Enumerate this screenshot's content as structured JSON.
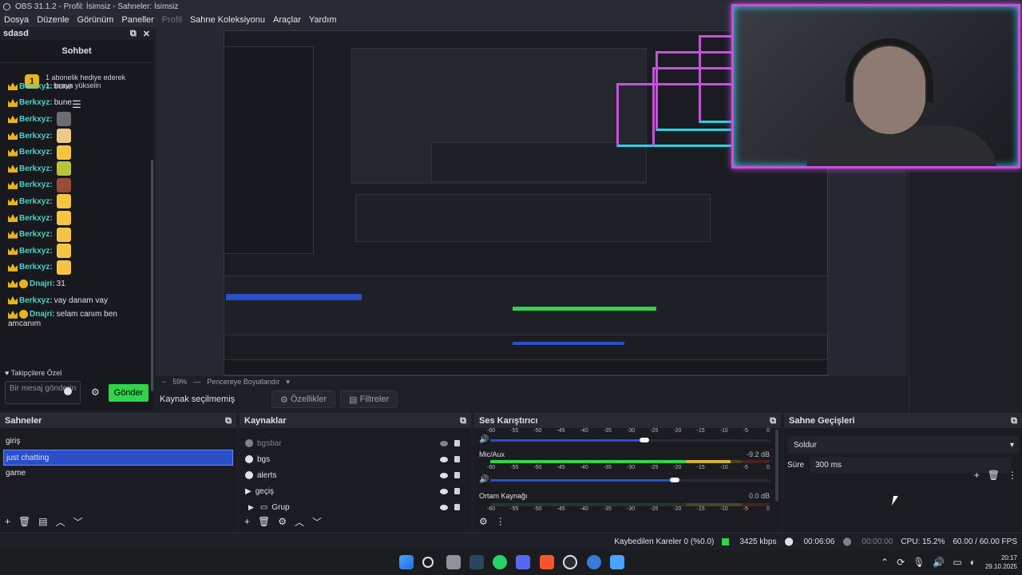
{
  "window": {
    "title": "OBS 31.1.2 - Profil: İsimsiz - Sahneler: İsimsiz"
  },
  "menu": {
    "items": [
      "Dosya",
      "Düzenle",
      "Görünüm",
      "Paneller",
      "Profil",
      "Sahne Koleksiyonu",
      "Araçlar",
      "Yardım"
    ],
    "disabled": "Profil"
  },
  "chat": {
    "dock_title": "sdasd",
    "title": "Sohbet",
    "promo_badge": "1",
    "promo_line1": "1 abonelik hediye ederek",
    "promo_line2": "1. sıraya yükselin",
    "messages": [
      {
        "badge": "crown",
        "user": "Berkxyz:",
        "text": "bune",
        "emote": ""
      },
      {
        "badge": "crown",
        "user": "Berkxyz:",
        "text": "bune",
        "emote": ""
      },
      {
        "badge": "crown",
        "user": "Berkxyz:",
        "text": "",
        "emote": "#6b6d73"
      },
      {
        "badge": "crown",
        "user": "Berkxyz:",
        "text": "",
        "emote": "#f0c98a"
      },
      {
        "badge": "crown",
        "user": "Berkxyz:",
        "text": "",
        "emote": "#f5c542"
      },
      {
        "badge": "crown",
        "user": "Berkxyz:",
        "text": "",
        "emote": "#b9c43a"
      },
      {
        "badge": "crown",
        "user": "Berkxyz:",
        "text": "",
        "emote": "#9a4a3a"
      },
      {
        "badge": "crown",
        "user": "Berkxyz:",
        "text": "",
        "emote": "#f5c542"
      },
      {
        "badge": "crown",
        "user": "Berkxyz:",
        "text": "",
        "emote": "#f5c542"
      },
      {
        "badge": "crown",
        "user": "Berkxyz:",
        "text": "",
        "emote": "#f5c542"
      },
      {
        "badge": "crown",
        "user": "Berkxyz:",
        "text": "",
        "emote": "#f5c542"
      },
      {
        "badge": "crown",
        "user": "Berkxyz:",
        "text": "",
        "emote": "#f5c542"
      },
      {
        "badge": "coin",
        "user": "Dnajri:",
        "text": "31",
        "emote": ""
      },
      {
        "badge": "crown",
        "user": "Berkxyz:",
        "text": "vay danam vay",
        "emote": ""
      }
    ],
    "last_message_user": "Dnajri:",
    "last_message_text": "selam canım ben",
    "last_message_text2": "amcanım",
    "followers_label": "Takipçilere Özel",
    "input_placeholder": "Bir mesaj gönderin",
    "send_label": "Gönder"
  },
  "preview": {
    "zoom": "59%",
    "fit_label": "Pencereye Boyutlandır"
  },
  "source_bar": {
    "state": "Kaynak seçilmemiş",
    "properties_label": "Özellikler",
    "filters_label": "Filtreler"
  },
  "scenes": {
    "title": "Sahneler",
    "items": [
      "giriş",
      "just chatting",
      "game"
    ],
    "selected": "just chatting"
  },
  "sources": {
    "title": "Kaynaklar",
    "items": [
      {
        "name": "bgsbar",
        "hidden": true
      },
      {
        "name": "bgs",
        "hidden": false
      },
      {
        "name": "alerts",
        "hidden": false
      },
      {
        "name": "geçiş",
        "hidden": false
      },
      {
        "name": "Grup",
        "hidden": false
      }
    ]
  },
  "mixer": {
    "title": "Ses Karıştırıcı",
    "scale": [
      "-60",
      "-55",
      "-50",
      "-45",
      "-40",
      "-35",
      "-30",
      "-25",
      "-20",
      "-15",
      "-10",
      "-5",
      "0"
    ],
    "channels": [
      {
        "name": "",
        "db": "",
        "level": 0.0,
        "volume": 0.55
      },
      {
        "name": "Mic/Aux",
        "db": "-9.2 dB",
        "level": 0.86,
        "volume": 0.66
      },
      {
        "name": "Ortam Kaynağı",
        "db": "0.0 dB",
        "level": 0.0,
        "volume": 0.0
      }
    ]
  },
  "transitions": {
    "title": "Sahne Geçişleri",
    "selected": "Soldur",
    "duration_label": "Süre",
    "duration_value": "300 ms"
  },
  "status": {
    "dropped": "Kaybedilen Kareler 0 (%0.0)",
    "bitrate": "3425 kbps",
    "rec_time": "00:06:06",
    "stream_time": "00:00:00",
    "cpu": "CPU: 15.2%",
    "fps": "60.00 / 60.00 FPS"
  },
  "taskbar": {
    "time": "20:17",
    "date": "29.10.2025"
  },
  "colors": {
    "accent": "#2b4ec9",
    "send": "#2fd44a",
    "username": "#4fd1c5",
    "badge": "#e7b41b",
    "neon_pink": "#c94fe0",
    "neon_cyan": "#2ad4e8"
  }
}
